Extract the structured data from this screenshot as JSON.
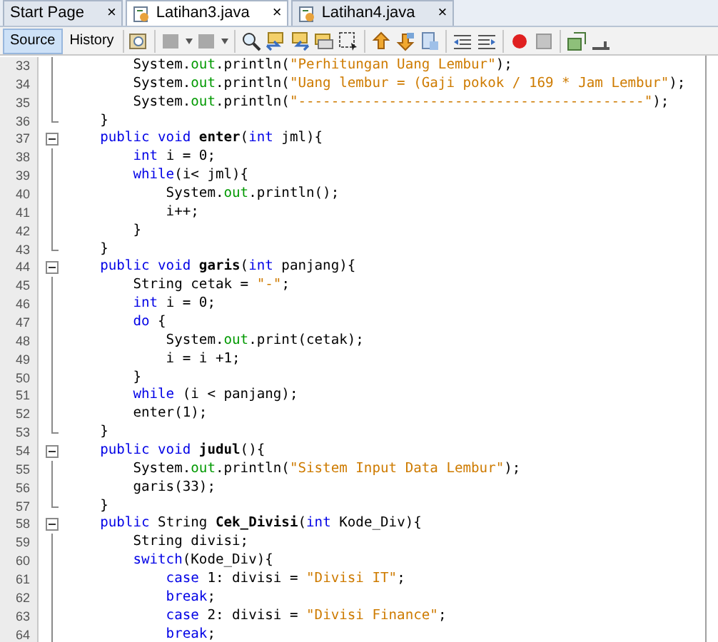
{
  "tabs": [
    {
      "label": "Start Page",
      "close": "×",
      "selected": false,
      "kind": "page"
    },
    {
      "label": "Latihan3.java",
      "close": "×",
      "selected": true,
      "kind": "java"
    },
    {
      "label": "Latihan4.java",
      "close": "×",
      "selected": false,
      "kind": "java"
    }
  ],
  "view_buttons": [
    {
      "label": "Source",
      "selected": true
    },
    {
      "label": "History",
      "selected": false
    }
  ],
  "lines": [
    {
      "number": "33",
      "kind": "body",
      "tokens": [
        {
          "kind": "plain",
          "text": "        System."
        },
        {
          "kind": "field",
          "text": "out"
        },
        {
          "kind": "plain",
          "text": ".println("
        },
        {
          "kind": "string",
          "text": "\"Perhitungan Uang Lembur\""
        },
        {
          "kind": "plain",
          "text": ");"
        }
      ]
    },
    {
      "number": "34",
      "kind": "body",
      "tokens": [
        {
          "kind": "plain",
          "text": "        System."
        },
        {
          "kind": "field",
          "text": "out"
        },
        {
          "kind": "plain",
          "text": ".println("
        },
        {
          "kind": "string",
          "text": "\"Uang lembur = (Gaji pokok / 169 * Jam Lembur\""
        },
        {
          "kind": "plain",
          "text": ");"
        }
      ]
    },
    {
      "number": "35",
      "kind": "body",
      "tokens": [
        {
          "kind": "plain",
          "text": "        System."
        },
        {
          "kind": "field",
          "text": "out"
        },
        {
          "kind": "plain",
          "text": ".println("
        },
        {
          "kind": "string",
          "text": "\"------------------------------------------\""
        },
        {
          "kind": "plain",
          "text": ");"
        }
      ]
    },
    {
      "number": "36",
      "kind": "closer",
      "tokens": [
        {
          "kind": "plain",
          "text": "    }"
        }
      ]
    },
    {
      "number": "37",
      "kind": "opener",
      "expanded": true,
      "tokens": [
        {
          "kind": "keyword",
          "text": "    public void"
        },
        {
          "kind": "method",
          "text": " enter"
        },
        {
          "kind": "plain",
          "text": "("
        },
        {
          "kind": "keyword",
          "text": "int"
        },
        {
          "kind": "plain",
          "text": " jml){"
        }
      ]
    },
    {
      "number": "38",
      "kind": "body",
      "tokens": [
        {
          "kind": "keyword",
          "text": "        int"
        },
        {
          "kind": "plain",
          "text": " i = 0;"
        }
      ]
    },
    {
      "number": "39",
      "kind": "body",
      "tokens": [
        {
          "kind": "keyword",
          "text": "        while"
        },
        {
          "kind": "plain",
          "text": "(i< jml){"
        }
      ]
    },
    {
      "number": "40",
      "kind": "body",
      "tokens": [
        {
          "kind": "plain",
          "text": "            System."
        },
        {
          "kind": "field",
          "text": "out"
        },
        {
          "kind": "plain",
          "text": ".println();"
        }
      ]
    },
    {
      "number": "41",
      "kind": "body",
      "tokens": [
        {
          "kind": "plain",
          "text": "            i++;"
        }
      ]
    },
    {
      "number": "42",
      "kind": "body",
      "tokens": [
        {
          "kind": "plain",
          "text": "        }"
        }
      ]
    },
    {
      "number": "43",
      "kind": "closer",
      "tokens": [
        {
          "kind": "plain",
          "text": "    }"
        }
      ]
    },
    {
      "number": "44",
      "kind": "opener",
      "expanded": true,
      "tokens": [
        {
          "kind": "keyword",
          "text": "    public void"
        },
        {
          "kind": "method",
          "text": " garis"
        },
        {
          "kind": "plain",
          "text": "("
        },
        {
          "kind": "keyword",
          "text": "int"
        },
        {
          "kind": "plain",
          "text": " panjang){"
        }
      ]
    },
    {
      "number": "45",
      "kind": "body",
      "tokens": [
        {
          "kind": "plain",
          "text": "        String cetak = "
        },
        {
          "kind": "string",
          "text": "\"-\""
        },
        {
          "kind": "plain",
          "text": ";"
        }
      ]
    },
    {
      "number": "46",
      "kind": "body",
      "tokens": [
        {
          "kind": "keyword",
          "text": "        int"
        },
        {
          "kind": "plain",
          "text": " i = 0;"
        }
      ]
    },
    {
      "number": "47",
      "kind": "body",
      "tokens": [
        {
          "kind": "keyword",
          "text": "        do"
        },
        {
          "kind": "plain",
          "text": " {"
        }
      ]
    },
    {
      "number": "48",
      "kind": "body",
      "tokens": [
        {
          "kind": "plain",
          "text": "            System."
        },
        {
          "kind": "field",
          "text": "out"
        },
        {
          "kind": "plain",
          "text": ".print(cetak);"
        }
      ]
    },
    {
      "number": "49",
      "kind": "body",
      "tokens": [
        {
          "kind": "plain",
          "text": "            i = i +1;"
        }
      ]
    },
    {
      "number": "50",
      "kind": "body",
      "tokens": [
        {
          "kind": "plain",
          "text": "        }"
        }
      ]
    },
    {
      "number": "51",
      "kind": "body",
      "tokens": [
        {
          "kind": "keyword",
          "text": "        while"
        },
        {
          "kind": "plain",
          "text": " (i < panjang);"
        }
      ]
    },
    {
      "number": "52",
      "kind": "body",
      "tokens": [
        {
          "kind": "plain",
          "text": "        enter(1);"
        }
      ]
    },
    {
      "number": "53",
      "kind": "closer",
      "tokens": [
        {
          "kind": "plain",
          "text": "    }"
        }
      ]
    },
    {
      "number": "54",
      "kind": "opener",
      "expanded": true,
      "tokens": [
        {
          "kind": "keyword",
          "text": "    public void"
        },
        {
          "kind": "method",
          "text": " judul"
        },
        {
          "kind": "plain",
          "text": "(){"
        }
      ]
    },
    {
      "number": "55",
      "kind": "body",
      "tokens": [
        {
          "kind": "plain",
          "text": "        System."
        },
        {
          "kind": "field",
          "text": "out"
        },
        {
          "kind": "plain",
          "text": ".println("
        },
        {
          "kind": "string",
          "text": "\"Sistem Input Data Lembur\""
        },
        {
          "kind": "plain",
          "text": ");"
        }
      ]
    },
    {
      "number": "56",
      "kind": "body",
      "tokens": [
        {
          "kind": "plain",
          "text": "        garis(33);"
        }
      ]
    },
    {
      "number": "57",
      "kind": "closer",
      "tokens": [
        {
          "kind": "plain",
          "text": "    }"
        }
      ]
    },
    {
      "number": "58",
      "kind": "opener",
      "expanded": true,
      "tokens": [
        {
          "kind": "keyword",
          "text": "    public"
        },
        {
          "kind": "plain",
          "text": " String"
        },
        {
          "kind": "method",
          "text": " Cek_Divisi"
        },
        {
          "kind": "plain",
          "text": "("
        },
        {
          "kind": "keyword",
          "text": "int"
        },
        {
          "kind": "plain",
          "text": " Kode_Div){"
        }
      ]
    },
    {
      "number": "59",
      "kind": "body",
      "tokens": [
        {
          "kind": "plain",
          "text": "        String divisi;"
        }
      ]
    },
    {
      "number": "60",
      "kind": "body",
      "tokens": [
        {
          "kind": "keyword",
          "text": "        switch"
        },
        {
          "kind": "plain",
          "text": "(Kode_Div){"
        }
      ]
    },
    {
      "number": "61",
      "kind": "body",
      "tokens": [
        {
          "kind": "keyword",
          "text": "            case"
        },
        {
          "kind": "plain",
          "text": " 1: divisi = "
        },
        {
          "kind": "string",
          "text": "\"Divisi IT\""
        },
        {
          "kind": "plain",
          "text": ";"
        }
      ]
    },
    {
      "number": "62",
      "kind": "body",
      "tokens": [
        {
          "kind": "keyword",
          "text": "            break"
        },
        {
          "kind": "plain",
          "text": ";"
        }
      ]
    },
    {
      "number": "63",
      "kind": "body",
      "tokens": [
        {
          "kind": "keyword",
          "text": "            case"
        },
        {
          "kind": "plain",
          "text": " 2: divisi = "
        },
        {
          "kind": "string",
          "text": "\"Divisi Finance\""
        },
        {
          "kind": "plain",
          "text": ";"
        }
      ]
    },
    {
      "number": "64",
      "kind": "body",
      "tokens": [
        {
          "kind": "keyword",
          "text": "            break"
        },
        {
          "kind": "plain",
          "text": ";"
        }
      ]
    }
  ]
}
